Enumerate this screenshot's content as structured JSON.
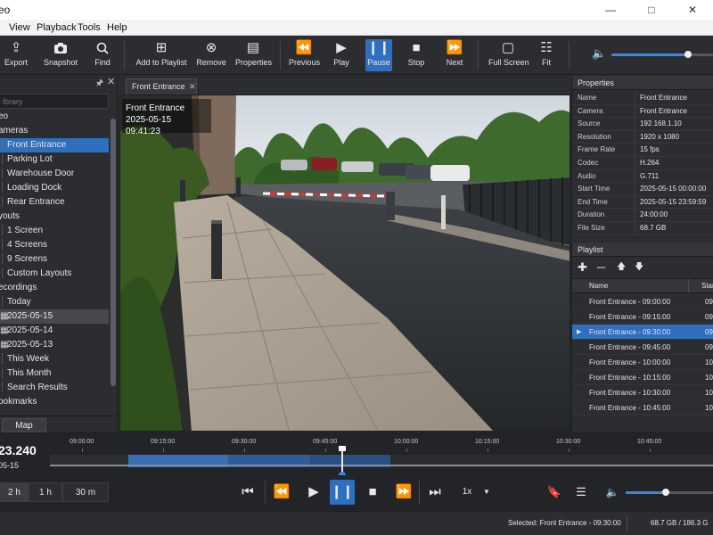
{
  "titlebar": {
    "title": "eo",
    "minimize_icon": "minimize-icon",
    "maximize_icon": "maximize-icon",
    "close_icon": "close-icon"
  },
  "menu": [
    "View",
    "Playback",
    "Tools",
    "Help"
  ],
  "toolbar": {
    "buttons": [
      {
        "label": "Export",
        "icon": "export-icon"
      },
      {
        "label": "Snapshot",
        "icon": "camera-icon"
      },
      {
        "label": "Find",
        "icon": "search-icon"
      },
      {
        "label": "Add to Playlist",
        "icon": "add-to-playlist-icon"
      },
      {
        "label": "Remove",
        "icon": "remove-icon"
      },
      {
        "label": "Properties",
        "icon": "properties-icon"
      },
      {
        "label": "Previous",
        "icon": "previous-icon"
      },
      {
        "label": "Play",
        "icon": "play-icon"
      },
      {
        "label": "Pause",
        "icon": "pause-icon",
        "active": true
      },
      {
        "label": "Stop",
        "icon": "stop-icon"
      },
      {
        "label": "Next",
        "icon": "next-icon"
      },
      {
        "label": "Full Screen",
        "icon": "fullscreen-icon"
      },
      {
        "label": "Fit",
        "icon": "fit-icon"
      }
    ],
    "volume_level": 0.75
  },
  "library": {
    "search_placeholder": "ibrary",
    "items": [
      {
        "label": "eo",
        "level": 0
      },
      {
        "label": "ameras",
        "level": 0
      },
      {
        "label": "Front Entrance",
        "level": 1,
        "selected": true
      },
      {
        "label": "Parking Lot",
        "level": 1
      },
      {
        "label": "Warehouse Door",
        "level": 1
      },
      {
        "label": "Loading Dock",
        "level": 1
      },
      {
        "label": "Rear Entrance",
        "level": 1
      },
      {
        "label": "youts",
        "level": 0
      },
      {
        "label": "1 Screen",
        "level": 1
      },
      {
        "label": "4 Screens",
        "level": 1
      },
      {
        "label": "9 Screens",
        "level": 1
      },
      {
        "label": "Custom Layouts",
        "level": 1
      },
      {
        "label": "ecordings",
        "level": 0
      },
      {
        "label": "Today",
        "level": 1
      },
      {
        "label": "2025-05-15",
        "level": 1,
        "icon": "calendar-icon",
        "highlight": true
      },
      {
        "label": "2025-05-14",
        "level": 1,
        "icon": "calendar-icon"
      },
      {
        "label": "2025-05-13",
        "level": 1,
        "icon": "calendar-icon"
      },
      {
        "label": "This Week",
        "level": 1
      },
      {
        "label": "This Month",
        "level": 1
      },
      {
        "label": "Search Results",
        "level": 1
      },
      {
        "label": "ookmarks",
        "level": 0
      }
    ],
    "tabs": [
      "",
      "Map"
    ]
  },
  "video": {
    "tab_label": "Front Entrance",
    "osd_camera": "Front Entrance",
    "osd_timestamp": "2025-05-15  09:41:23"
  },
  "properties": {
    "title": "Properties",
    "rows": [
      {
        "k": "Name",
        "v": "Front Entrance"
      },
      {
        "k": "Camera",
        "v": "Front Entrance"
      },
      {
        "k": "Source",
        "v": "192.168.1.10"
      },
      {
        "k": "Resolution",
        "v": "1920 x 1080"
      },
      {
        "k": "Frame Rate",
        "v": "15 fps"
      },
      {
        "k": "Codec",
        "v": "H.264"
      },
      {
        "k": "Audio",
        "v": "G.711"
      },
      {
        "k": "Start Time",
        "v": "2025-05-15 00:00:00"
      },
      {
        "k": "End Time",
        "v": "2025-05-15 23:59:59"
      },
      {
        "k": "Duration",
        "v": "24:00:00"
      },
      {
        "k": "File Size",
        "v": "68.7 GB"
      }
    ]
  },
  "playlist": {
    "title": "Playlist",
    "columns": [
      "Name",
      "Start"
    ],
    "rows": [
      {
        "name": "Front Entrance - 09:00:00",
        "start": "09"
      },
      {
        "name": "Front Entrance - 09:15:00",
        "start": "09"
      },
      {
        "name": "Front Entrance - 09:30:00",
        "start": "09",
        "selected": true
      },
      {
        "name": "Front Entrance - 09:45:00",
        "start": "09"
      },
      {
        "name": "Front Entrance - 10:00:00",
        "start": "10"
      },
      {
        "name": "Front Entrance - 10:15:00",
        "start": "10"
      },
      {
        "name": "Front Entrance - 10:30:00",
        "start": "10"
      },
      {
        "name": "Front Entrance - 10:45:00",
        "start": "10"
      }
    ]
  },
  "timeline": {
    "clock": "23.240",
    "date": "05-15",
    "ticks": [
      "09:00:00",
      "09:15:00",
      "09:30:00",
      "09:45:00",
      "10:00:00",
      "10:15:00",
      "10:30:00",
      "10:45:00"
    ],
    "zoom_options": [
      "2 h",
      "1 h",
      "30 m"
    ],
    "speed": "1x"
  },
  "status": {
    "selected": "Selected: Front Entrance - 09:30:00",
    "storage": "68.7 GB / 186.3 G"
  },
  "colors": {
    "accent": "#2f6fbd",
    "background": "#2b2d31",
    "panel_header": "#34363b"
  }
}
